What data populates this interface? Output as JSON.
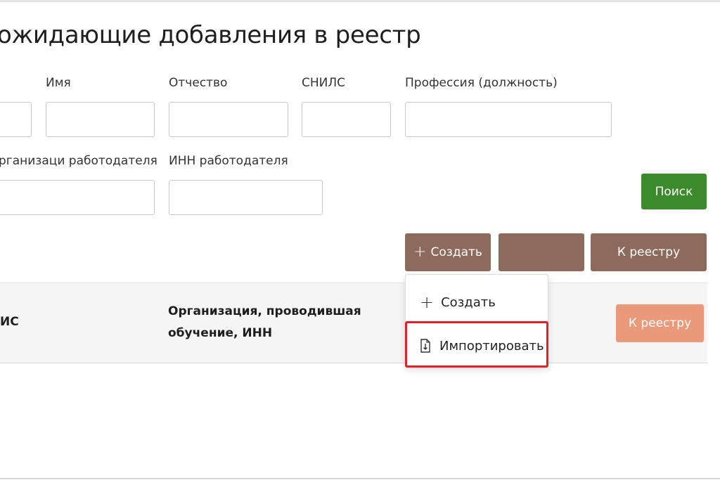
{
  "page": {
    "title": "ожидающие добавления в реестр"
  },
  "filters": {
    "first_name_label": "Имя",
    "patronymic_label": "Отчество",
    "snils_label": "СНИЛС",
    "profession_label": "Профессия (должность)",
    "employer_org_label": "рганизаци работодателя",
    "employer_inn_label": "ИНН работодателя",
    "search_button": "Поиск"
  },
  "toolbar": {
    "create_button": "Создать",
    "create_icon": "plus-icon",
    "unlabeled_button": "",
    "to_registry_button": "К реестру"
  },
  "table": {
    "headers": [
      "ИС",
      "Организация, проводившая обучение, ИНН"
    ],
    "row_action": "К реестру"
  },
  "dropdown": {
    "items": [
      {
        "label": "Создать",
        "icon": "plus-icon"
      },
      {
        "label": "Импортировать",
        "icon": "import-file-icon"
      }
    ]
  },
  "colors": {
    "search": "#3d8a2c",
    "toolbar": "#8e6a5c",
    "row_action": "#ea9a7a",
    "highlight": "#e0222a"
  }
}
